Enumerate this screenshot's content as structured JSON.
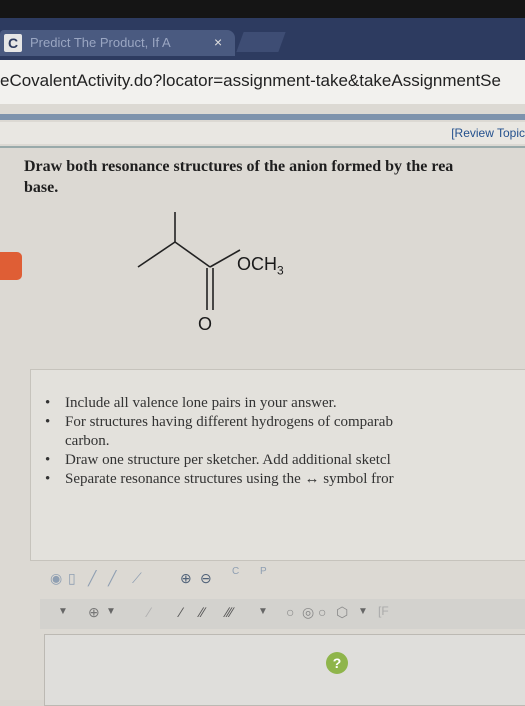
{
  "browser": {
    "tab": {
      "favicon": "C",
      "title": "Predict The Product, If A",
      "close": "×"
    },
    "url": "eCovalentActivity.do?locator=assignment-take&takeAssignmentSe"
  },
  "header": {
    "review_link": "[Review Topic"
  },
  "question": {
    "text": "Draw both resonance structures of the anion formed by the rea",
    "text2": "base."
  },
  "structure": {
    "substituent": "OCH",
    "substituent_sub": "3",
    "carbonyl_o": "O"
  },
  "instructions": [
    "Include all valence lone pairs in your answer.",
    "For structures having different hydrogens of comparab",
    "carbon.",
    "Draw one structure per sketcher. Add additional sketcl",
    "Separate resonance structures using the ↔ symbol fror"
  ],
  "toolbar": {
    "icons_row1": [
      "eraser-icon",
      "lasso-icon",
      "pencil-icon",
      "zoom-in-icon",
      "zoom-out-icon",
      "template-c-icon",
      "template-p-icon"
    ],
    "icons_row2": [
      "arrow-down-icon",
      "add-charge-icon",
      "bond-single-icon",
      "bond-double-icon",
      "bond-triple-icon",
      "ring-icon"
    ]
  },
  "help_label": "?"
}
